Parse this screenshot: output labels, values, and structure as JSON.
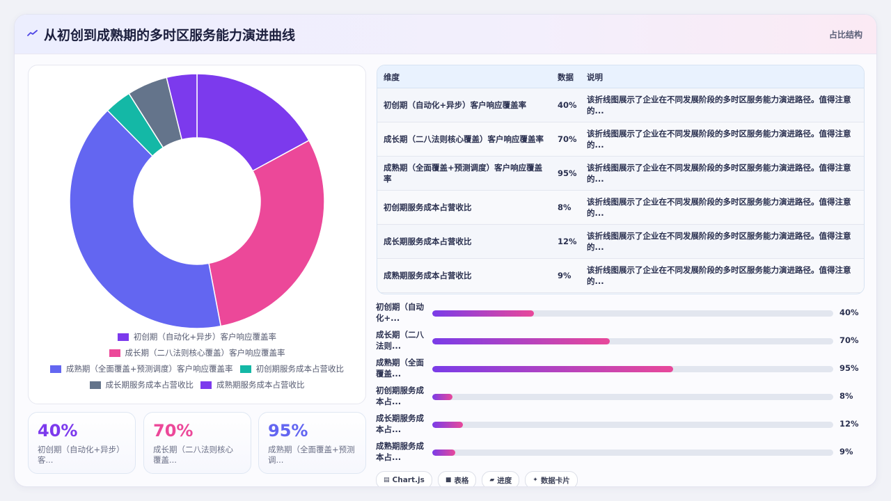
{
  "header": {
    "title": "从初创到成熟期的多时区服务能力演进曲线",
    "tag": "占比结构"
  },
  "chart_data": {
    "type": "pie",
    "categories": [
      "初创期（自动化+异步）客户响应覆盖率",
      "成长期（二八法则核心覆盖）客户响应覆盖率",
      "成熟期（全面覆盖+预测调度）客户响应覆盖率",
      "初创期服务成本占营收比",
      "成长期服务成本占营收比",
      "成熟期服务成本占营收比"
    ],
    "values": [
      40,
      70,
      95,
      8,
      12,
      9
    ],
    "colors": [
      "#7c3aed",
      "#ec4899",
      "#6366f1",
      "#14b8a6",
      "#64748b",
      "#7c3aed"
    ],
    "legend_position": "bottom"
  },
  "stats": [
    {
      "value": "40%",
      "label": "初创期（自动化+异步）客...",
      "color": "#7c3aed"
    },
    {
      "value": "70%",
      "label": "成长期（二八法则核心覆盖...",
      "color": "#ec4899"
    },
    {
      "value": "95%",
      "label": "成熟期（全面覆盖+预测调...",
      "color": "#6366f1"
    }
  ],
  "table": {
    "headers": [
      "维度",
      "数据",
      "说明"
    ],
    "rows": [
      {
        "dim": "初创期（自动化+异步）客户响应覆盖率",
        "val": "40%",
        "desc": "该折线图展示了企业在不同发展阶段的多时区服务能力演进路径。值得注意的..."
      },
      {
        "dim": "成长期（二八法则核心覆盖）客户响应覆盖率",
        "val": "70%",
        "desc": "该折线图展示了企业在不同发展阶段的多时区服务能力演进路径。值得注意的..."
      },
      {
        "dim": "成熟期（全面覆盖+预测调度）客户响应覆盖率",
        "val": "95%",
        "desc": "该折线图展示了企业在不同发展阶段的多时区服务能力演进路径。值得注意的..."
      },
      {
        "dim": "初创期服务成本占营收比",
        "val": "8%",
        "desc": "该折线图展示了企业在不同发展阶段的多时区服务能力演进路径。值得注意的..."
      },
      {
        "dim": "成长期服务成本占营收比",
        "val": "12%",
        "desc": "该折线图展示了企业在不同发展阶段的多时区服务能力演进路径。值得注意的..."
      },
      {
        "dim": "成熟期服务成本占营收比",
        "val": "9%",
        "desc": "该折线图展示了企业在不同发展阶段的多时区服务能力演进路径。值得注意的..."
      }
    ]
  },
  "bars": [
    {
      "label": "初创期（自动化+...",
      "value": 40,
      "text": "40%"
    },
    {
      "label": "成长期（二八法则...",
      "value": 70,
      "text": "70%"
    },
    {
      "label": "成熟期（全面覆盖...",
      "value": 95,
      "text": "95%"
    },
    {
      "label": "初创期服务成本占...",
      "value": 8,
      "text": "8%"
    },
    {
      "label": "成长期服务成本占...",
      "value": 12,
      "text": "12%"
    },
    {
      "label": "成熟期服务成本占...",
      "value": 9,
      "text": "9%"
    }
  ],
  "chips": [
    {
      "icon": "chart-icon",
      "label": "Chart.js"
    },
    {
      "icon": "table-icon",
      "label": "表格"
    },
    {
      "icon": "progress-icon",
      "label": "进度"
    },
    {
      "icon": "sparkle-icon",
      "label": "数据卡片"
    }
  ]
}
